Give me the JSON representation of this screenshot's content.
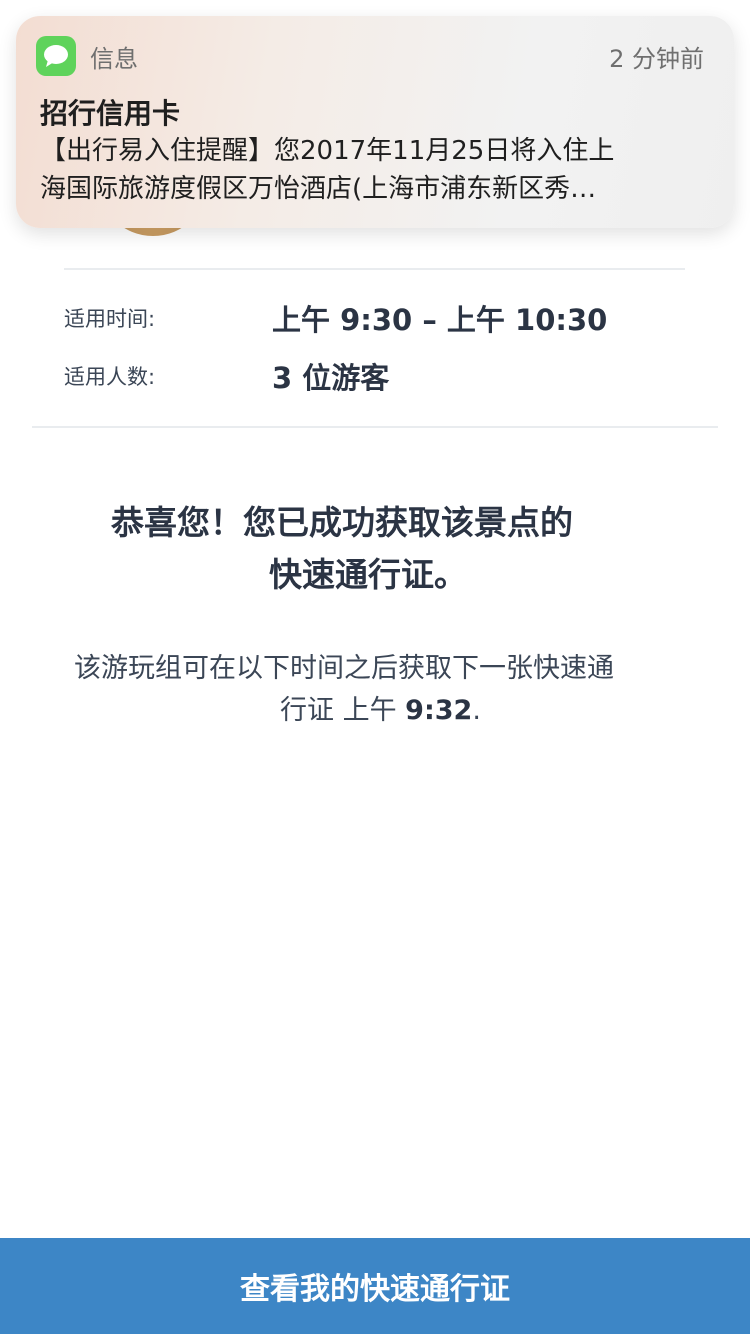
{
  "notification": {
    "app_name": "信息",
    "time": "2 分钟前",
    "title": "招行信用卡",
    "body_line1": "【出行易入住提醒】您2017年11月25日将入住上",
    "body_line2": "海国际旅游度假区万怡酒店(上海市浦东新区秀…",
    "icon": "messages-icon"
  },
  "details": {
    "time_label": "适用时间:",
    "time_value": "上午 9:30 – 上午 10:30",
    "people_label": "适用人数:",
    "people_value": "3 位游客"
  },
  "success": {
    "title_line1": "恭喜您！您已成功获取该景点的",
    "title_line2": "快速通行证。"
  },
  "next_pass": {
    "line1": "该游玩组可在以下时间之后获取下一张快速通",
    "line2_prefix": "行证 上午 ",
    "line2_time": "9:32",
    "line2_suffix": "."
  },
  "button": {
    "label": "查看我的快速通行证"
  },
  "colors": {
    "button_bg": "#3d86c6",
    "app_icon_green": "#5fd35b",
    "text_dark": "#2b3444"
  }
}
